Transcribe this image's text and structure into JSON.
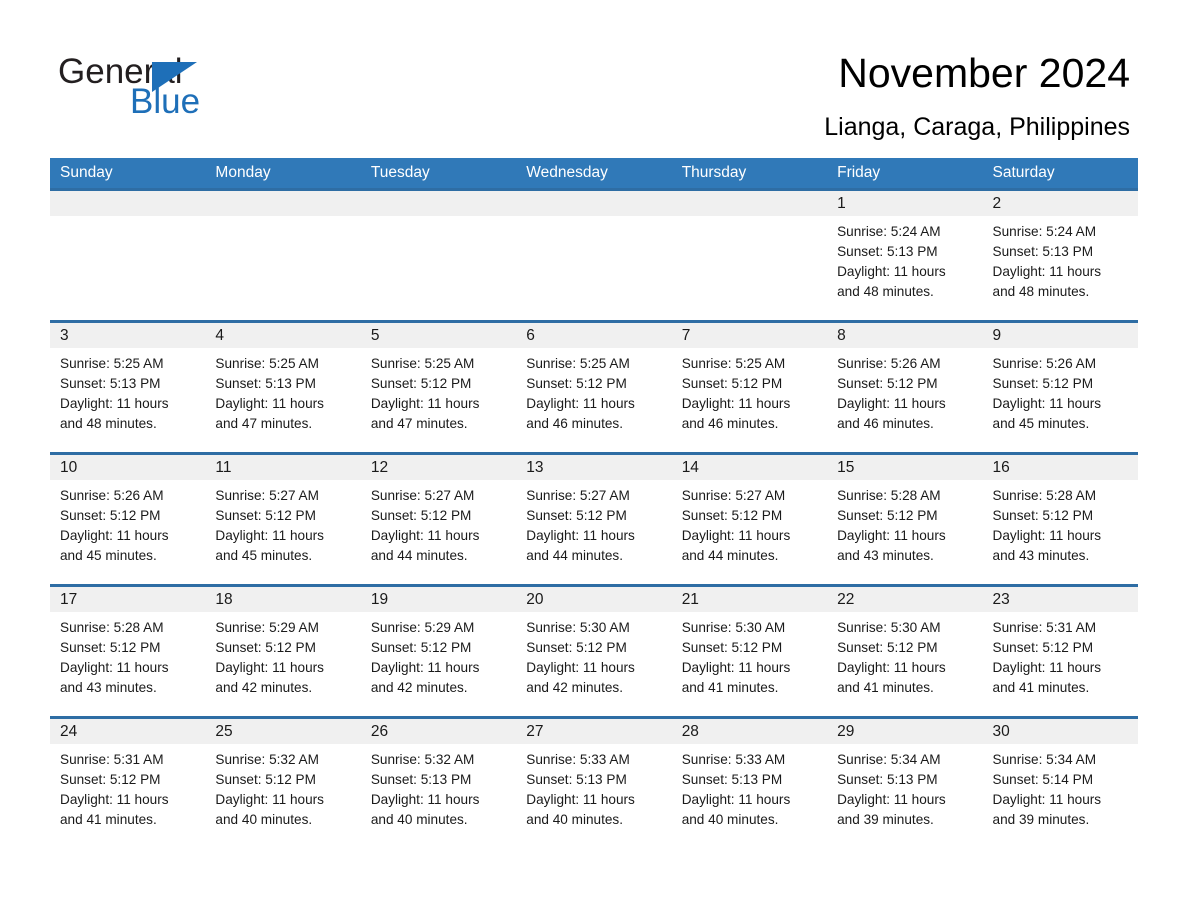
{
  "brand": {
    "name_part1": "General",
    "name_part2": "Blue",
    "accent_color": "#1e6fb8",
    "triangle_icon": "brand-triangle-icon"
  },
  "header": {
    "month_title": "November 2024",
    "location": "Lianga, Caraga, Philippines"
  },
  "theme": {
    "header_row_bg": "#3079b8",
    "row_divider": "#2e6da4",
    "daynum_bg": "#f0f0f0",
    "text": "#1a1a1a"
  },
  "weekdays": [
    "Sunday",
    "Monday",
    "Tuesday",
    "Wednesday",
    "Thursday",
    "Friday",
    "Saturday"
  ],
  "weeks": [
    [
      {
        "day": "",
        "empty": true
      },
      {
        "day": "",
        "empty": true
      },
      {
        "day": "",
        "empty": true
      },
      {
        "day": "",
        "empty": true
      },
      {
        "day": "",
        "empty": true
      },
      {
        "day": "1",
        "sunrise": "Sunrise: 5:24 AM",
        "sunset": "Sunset: 5:13 PM",
        "daylight_line1": "Daylight: 11 hours",
        "daylight_line2": "and 48 minutes."
      },
      {
        "day": "2",
        "sunrise": "Sunrise: 5:24 AM",
        "sunset": "Sunset: 5:13 PM",
        "daylight_line1": "Daylight: 11 hours",
        "daylight_line2": "and 48 minutes."
      }
    ],
    [
      {
        "day": "3",
        "sunrise": "Sunrise: 5:25 AM",
        "sunset": "Sunset: 5:13 PM",
        "daylight_line1": "Daylight: 11 hours",
        "daylight_line2": "and 48 minutes."
      },
      {
        "day": "4",
        "sunrise": "Sunrise: 5:25 AM",
        "sunset": "Sunset: 5:13 PM",
        "daylight_line1": "Daylight: 11 hours",
        "daylight_line2": "and 47 minutes."
      },
      {
        "day": "5",
        "sunrise": "Sunrise: 5:25 AM",
        "sunset": "Sunset: 5:12 PM",
        "daylight_line1": "Daylight: 11 hours",
        "daylight_line2": "and 47 minutes."
      },
      {
        "day": "6",
        "sunrise": "Sunrise: 5:25 AM",
        "sunset": "Sunset: 5:12 PM",
        "daylight_line1": "Daylight: 11 hours",
        "daylight_line2": "and 46 minutes."
      },
      {
        "day": "7",
        "sunrise": "Sunrise: 5:25 AM",
        "sunset": "Sunset: 5:12 PM",
        "daylight_line1": "Daylight: 11 hours",
        "daylight_line2": "and 46 minutes."
      },
      {
        "day": "8",
        "sunrise": "Sunrise: 5:26 AM",
        "sunset": "Sunset: 5:12 PM",
        "daylight_line1": "Daylight: 11 hours",
        "daylight_line2": "and 46 minutes."
      },
      {
        "day": "9",
        "sunrise": "Sunrise: 5:26 AM",
        "sunset": "Sunset: 5:12 PM",
        "daylight_line1": "Daylight: 11 hours",
        "daylight_line2": "and 45 minutes."
      }
    ],
    [
      {
        "day": "10",
        "sunrise": "Sunrise: 5:26 AM",
        "sunset": "Sunset: 5:12 PM",
        "daylight_line1": "Daylight: 11 hours",
        "daylight_line2": "and 45 minutes."
      },
      {
        "day": "11",
        "sunrise": "Sunrise: 5:27 AM",
        "sunset": "Sunset: 5:12 PM",
        "daylight_line1": "Daylight: 11 hours",
        "daylight_line2": "and 45 minutes."
      },
      {
        "day": "12",
        "sunrise": "Sunrise: 5:27 AM",
        "sunset": "Sunset: 5:12 PM",
        "daylight_line1": "Daylight: 11 hours",
        "daylight_line2": "and 44 minutes."
      },
      {
        "day": "13",
        "sunrise": "Sunrise: 5:27 AM",
        "sunset": "Sunset: 5:12 PM",
        "daylight_line1": "Daylight: 11 hours",
        "daylight_line2": "and 44 minutes."
      },
      {
        "day": "14",
        "sunrise": "Sunrise: 5:27 AM",
        "sunset": "Sunset: 5:12 PM",
        "daylight_line1": "Daylight: 11 hours",
        "daylight_line2": "and 44 minutes."
      },
      {
        "day": "15",
        "sunrise": "Sunrise: 5:28 AM",
        "sunset": "Sunset: 5:12 PM",
        "daylight_line1": "Daylight: 11 hours",
        "daylight_line2": "and 43 minutes."
      },
      {
        "day": "16",
        "sunrise": "Sunrise: 5:28 AM",
        "sunset": "Sunset: 5:12 PM",
        "daylight_line1": "Daylight: 11 hours",
        "daylight_line2": "and 43 minutes."
      }
    ],
    [
      {
        "day": "17",
        "sunrise": "Sunrise: 5:28 AM",
        "sunset": "Sunset: 5:12 PM",
        "daylight_line1": "Daylight: 11 hours",
        "daylight_line2": "and 43 minutes."
      },
      {
        "day": "18",
        "sunrise": "Sunrise: 5:29 AM",
        "sunset": "Sunset: 5:12 PM",
        "daylight_line1": "Daylight: 11 hours",
        "daylight_line2": "and 42 minutes."
      },
      {
        "day": "19",
        "sunrise": "Sunrise: 5:29 AM",
        "sunset": "Sunset: 5:12 PM",
        "daylight_line1": "Daylight: 11 hours",
        "daylight_line2": "and 42 minutes."
      },
      {
        "day": "20",
        "sunrise": "Sunrise: 5:30 AM",
        "sunset": "Sunset: 5:12 PM",
        "daylight_line1": "Daylight: 11 hours",
        "daylight_line2": "and 42 minutes."
      },
      {
        "day": "21",
        "sunrise": "Sunrise: 5:30 AM",
        "sunset": "Sunset: 5:12 PM",
        "daylight_line1": "Daylight: 11 hours",
        "daylight_line2": "and 41 minutes."
      },
      {
        "day": "22",
        "sunrise": "Sunrise: 5:30 AM",
        "sunset": "Sunset: 5:12 PM",
        "daylight_line1": "Daylight: 11 hours",
        "daylight_line2": "and 41 minutes."
      },
      {
        "day": "23",
        "sunrise": "Sunrise: 5:31 AM",
        "sunset": "Sunset: 5:12 PM",
        "daylight_line1": "Daylight: 11 hours",
        "daylight_line2": "and 41 minutes."
      }
    ],
    [
      {
        "day": "24",
        "sunrise": "Sunrise: 5:31 AM",
        "sunset": "Sunset: 5:12 PM",
        "daylight_line1": "Daylight: 11 hours",
        "daylight_line2": "and 41 minutes."
      },
      {
        "day": "25",
        "sunrise": "Sunrise: 5:32 AM",
        "sunset": "Sunset: 5:12 PM",
        "daylight_line1": "Daylight: 11 hours",
        "daylight_line2": "and 40 minutes."
      },
      {
        "day": "26",
        "sunrise": "Sunrise: 5:32 AM",
        "sunset": "Sunset: 5:13 PM",
        "daylight_line1": "Daylight: 11 hours",
        "daylight_line2": "and 40 minutes."
      },
      {
        "day": "27",
        "sunrise": "Sunrise: 5:33 AM",
        "sunset": "Sunset: 5:13 PM",
        "daylight_line1": "Daylight: 11 hours",
        "daylight_line2": "and 40 minutes."
      },
      {
        "day": "28",
        "sunrise": "Sunrise: 5:33 AM",
        "sunset": "Sunset: 5:13 PM",
        "daylight_line1": "Daylight: 11 hours",
        "daylight_line2": "and 40 minutes."
      },
      {
        "day": "29",
        "sunrise": "Sunrise: 5:34 AM",
        "sunset": "Sunset: 5:13 PM",
        "daylight_line1": "Daylight: 11 hours",
        "daylight_line2": "and 39 minutes."
      },
      {
        "day": "30",
        "sunrise": "Sunrise: 5:34 AM",
        "sunset": "Sunset: 5:14 PM",
        "daylight_line1": "Daylight: 11 hours",
        "daylight_line2": "and 39 minutes."
      }
    ]
  ]
}
